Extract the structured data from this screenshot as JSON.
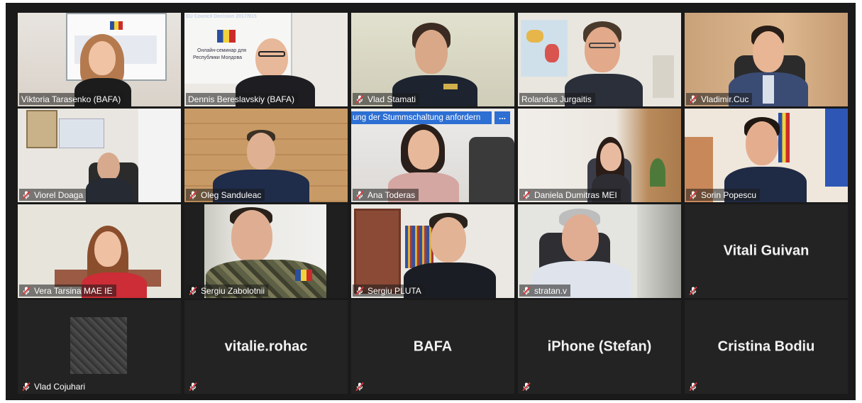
{
  "meeting": {
    "speaker_banner": "ung der Stummschaltung anfordern",
    "banner_more": "...",
    "slide": {
      "header": "EU Council Decision 2017/915",
      "line1": "Онлайн-семинар для",
      "line2": "Республики Молдова"
    },
    "participants": [
      {
        "name": "Viktoria Tarasenko (BAFA)",
        "video": true
      },
      {
        "name": "Dennis Bereslavskiy (BAFA)",
        "video": true
      },
      {
        "name": "Vlad Stamati",
        "video": true
      },
      {
        "name": "Rolandas Jurgaitis",
        "video": true,
        "active_speaker": true
      },
      {
        "name": "Vladimir.Cuc",
        "video": true
      },
      {
        "name": "Viorel Doaga",
        "video": true
      },
      {
        "name": "Oleg Sanduleac",
        "video": true
      },
      {
        "name": "Ana Toderas",
        "video": true
      },
      {
        "name": "Daniela Dumitras MEI",
        "video": true
      },
      {
        "name": "Sorin Popescu",
        "video": true
      },
      {
        "name": "Vera Tarsina MAE IE",
        "video": true
      },
      {
        "name": "Sergiu Zabolotnii",
        "video": true
      },
      {
        "name": "Sergiu PLUTA",
        "video": true
      },
      {
        "name": "stratan.v",
        "video": true
      },
      {
        "name": "Vitali Guivan",
        "video": false
      },
      {
        "name": "Vlad Cojuhari",
        "video": true
      },
      {
        "name": "vitalie.rohac",
        "video": false
      },
      {
        "name": "BAFA",
        "video": false
      },
      {
        "name": "iPhone (Stefan)",
        "video": false
      },
      {
        "name": "Cristina Bodiu",
        "video": false
      }
    ]
  },
  "colors": {
    "active_speaker_border": "#d6e36a",
    "muted_icon": "#e0393e",
    "tile_empty": "#232323",
    "banner": "#2d6fd3"
  },
  "icons": {
    "muted": "microphone-muted-icon",
    "more": "more-options-icon"
  }
}
